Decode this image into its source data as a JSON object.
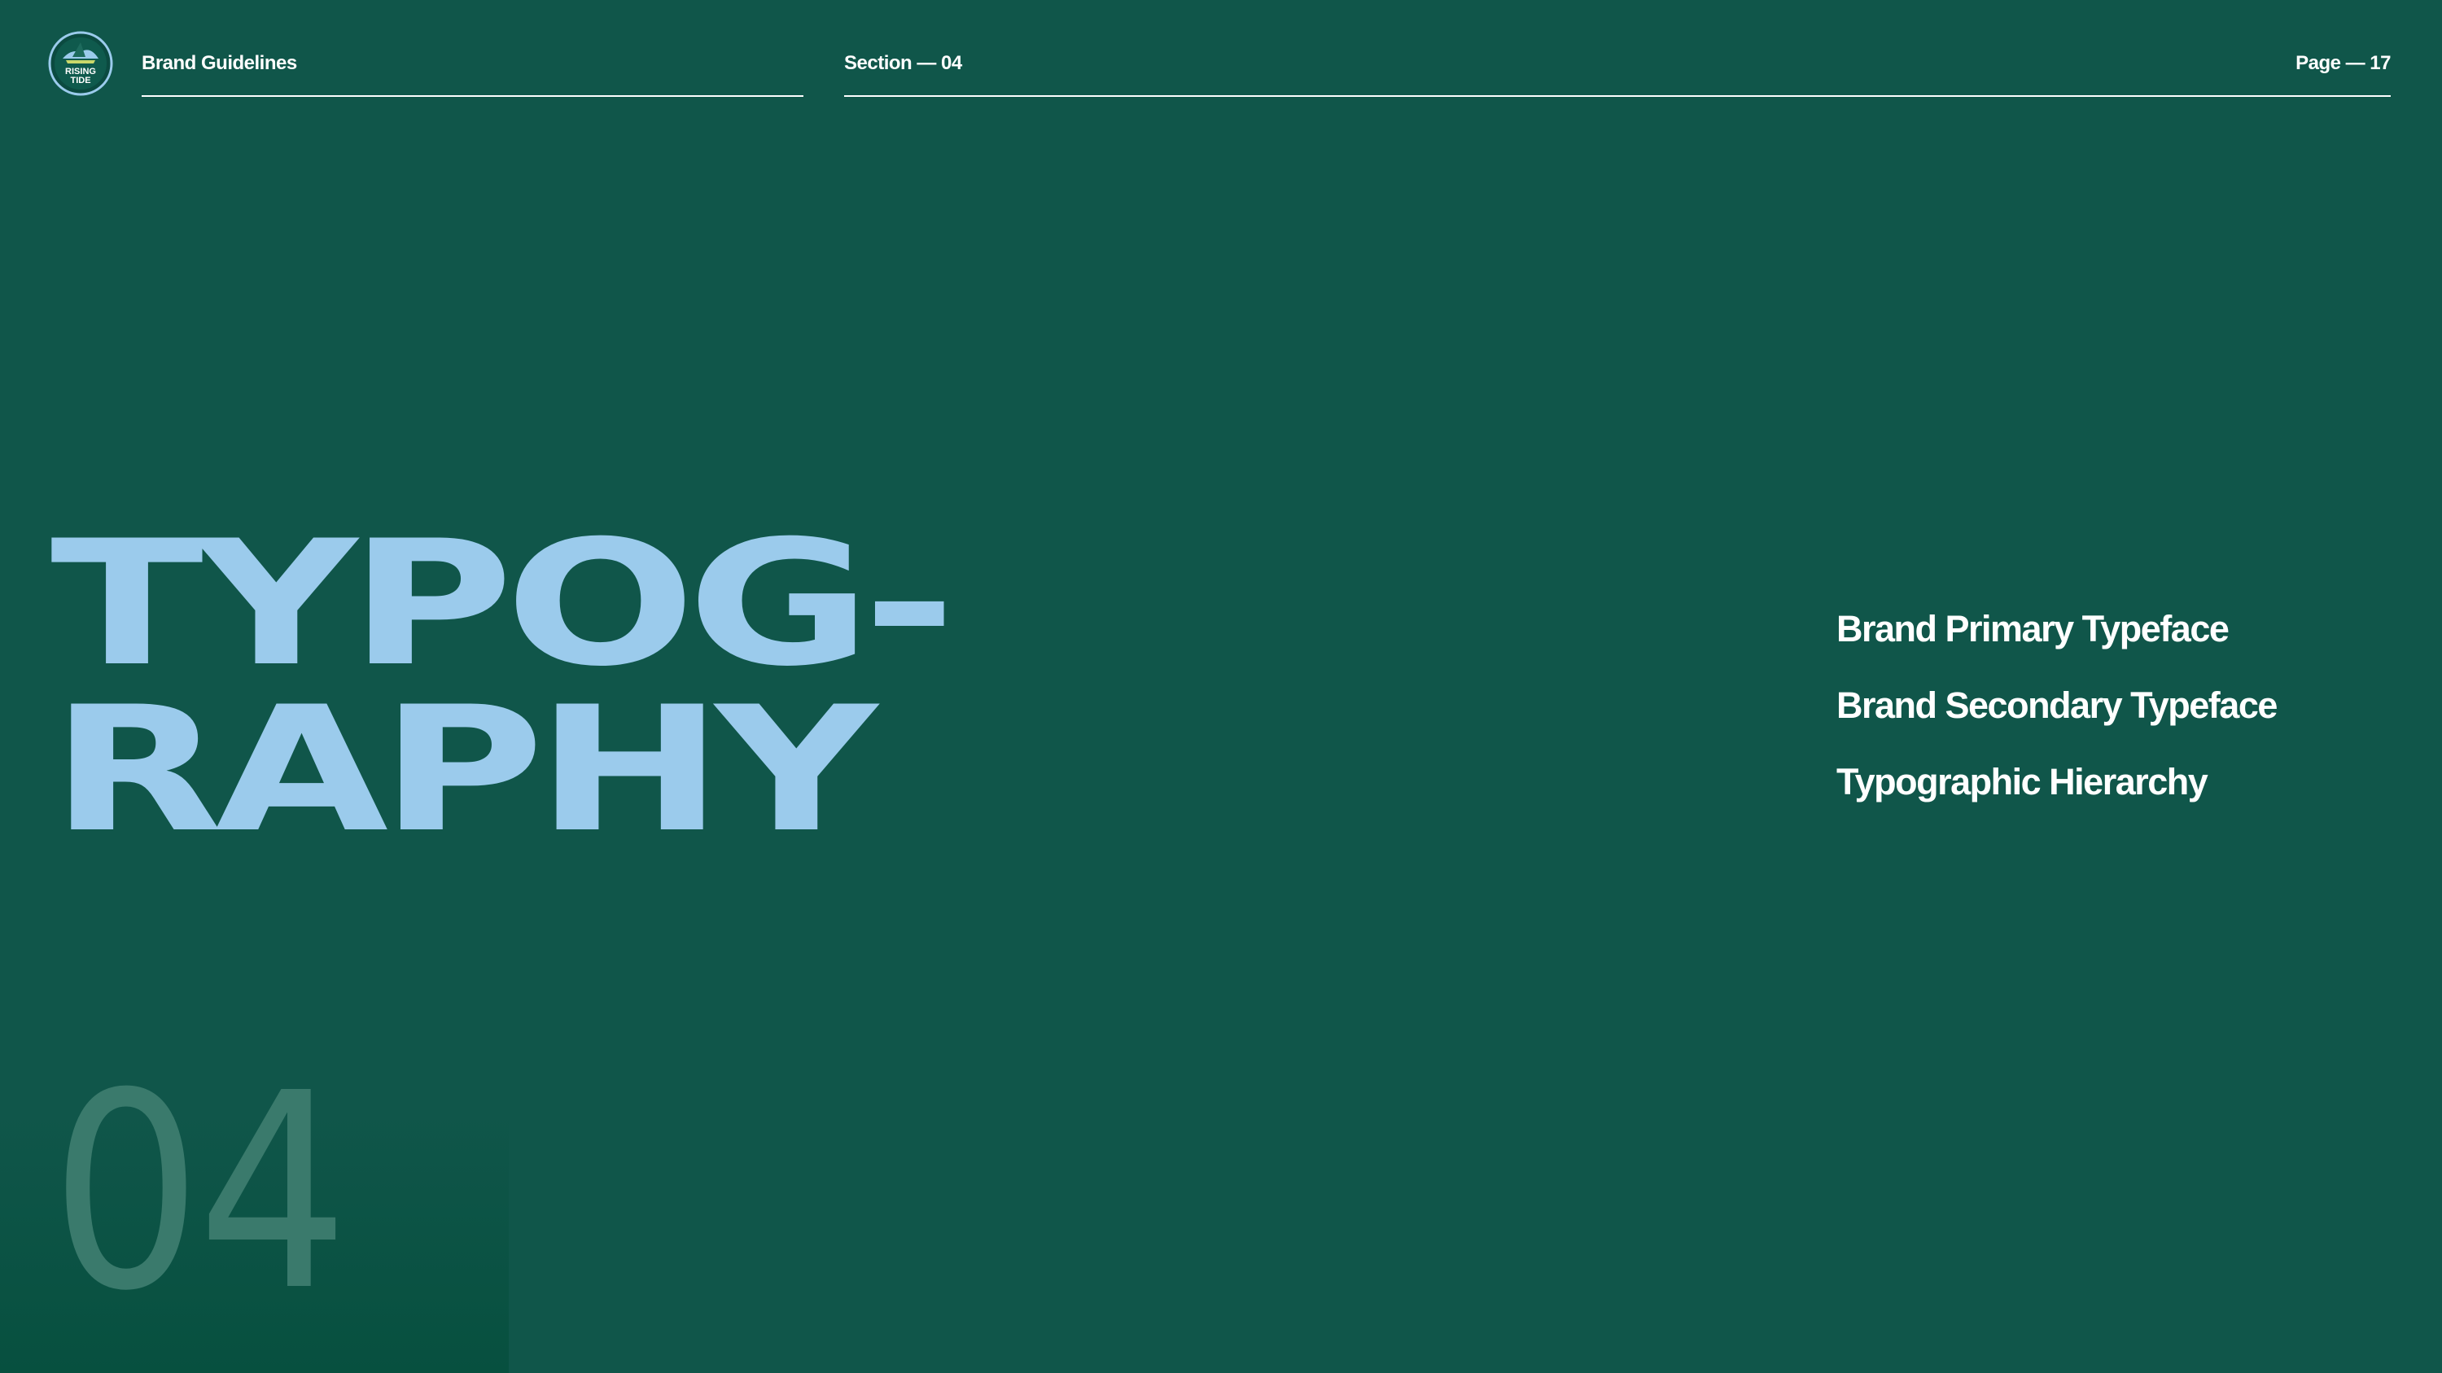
{
  "header": {
    "brand": "Brand Guidelines",
    "section": "Section — 04",
    "page": "Page — 17"
  },
  "logo": {
    "text_line1": "RISING",
    "text_line2": "TIDE",
    "icon": "rising-tide-logo-icon"
  },
  "title": {
    "line1": "TYPOG-",
    "line2": "RAPHY"
  },
  "menu": {
    "items": [
      {
        "label": "Brand Primary Typeface"
      },
      {
        "label": "Brand Secondary Typeface"
      },
      {
        "label": "Typographic Hierarchy"
      }
    ]
  },
  "section_number": "04",
  "colors": {
    "background": "#10564a",
    "title": "#9bcbec",
    "text": "#ffffff",
    "number": "#3a7a6c"
  }
}
